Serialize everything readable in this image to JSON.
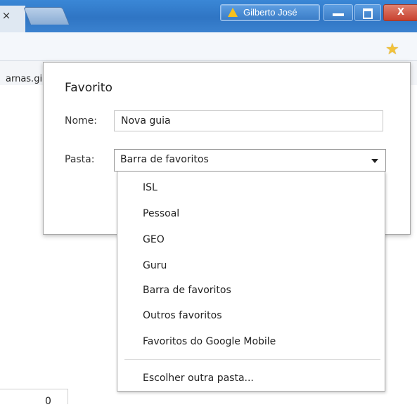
{
  "titlebar": {
    "tab_close": "×",
    "profile_name": "Gilberto José",
    "close_label": "X"
  },
  "bookmark_bar": {
    "item_fragment": "arnas.gi"
  },
  "bubble": {
    "title": "Favorito",
    "name_label": "Nome:",
    "name_value": "Nova guia",
    "folder_label": "Pasta:",
    "folder_selected": "Barra de favoritos"
  },
  "dropdown": {
    "options": [
      "ISL",
      "Pessoal",
      "GEO",
      "Guru",
      "Barra de favoritos",
      "Outros favoritos",
      "Favoritos do Google Mobile"
    ],
    "choose_other": "Escolher outra pasta..."
  },
  "bottom": {
    "value": "0"
  },
  "icons": {
    "star": "star-icon",
    "warning": "warning-icon",
    "dropdown_arrow": "chevron-down-icon"
  },
  "colors": {
    "titlebar": "#2f75c4",
    "star": "#f2c23a",
    "close_button": "#c8412e"
  }
}
